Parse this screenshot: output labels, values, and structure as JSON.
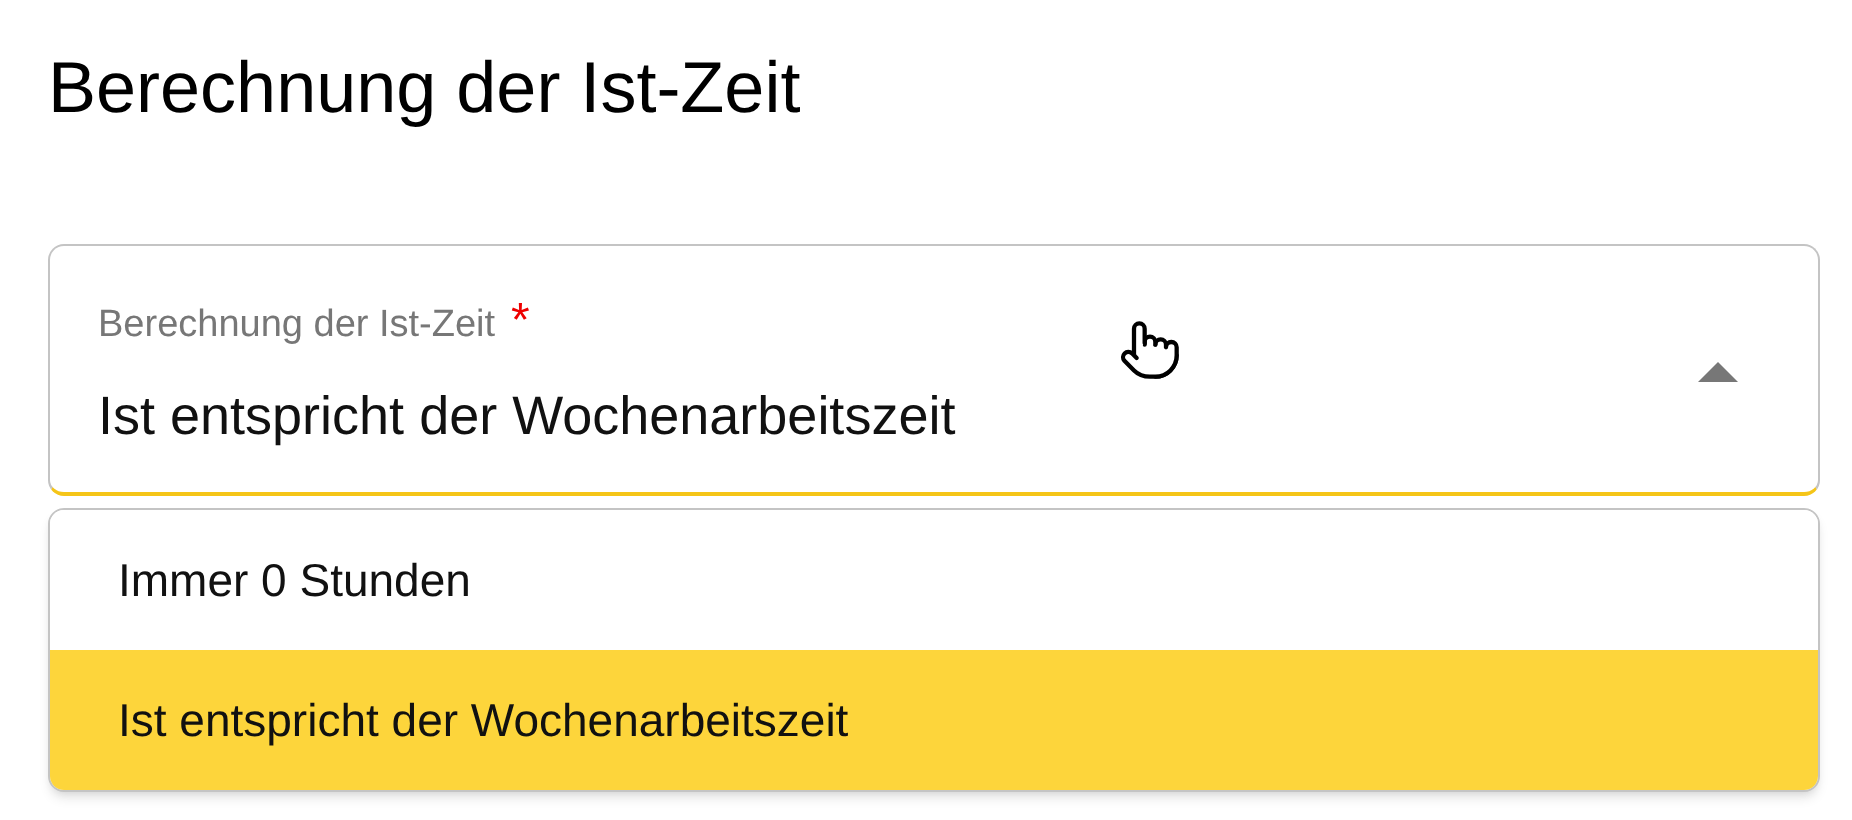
{
  "heading": "Berechnung der Ist-Zeit",
  "select": {
    "label": "Berechnung der Ist-Zeit",
    "required_mark": "*",
    "value": "Ist entspricht der Wochenarbeitszeit",
    "expanded": true
  },
  "options": [
    {
      "label": "Immer 0 Stunden",
      "selected": false
    },
    {
      "label": "Ist entspricht der Wochenarbeitszeit",
      "selected": true
    }
  ]
}
